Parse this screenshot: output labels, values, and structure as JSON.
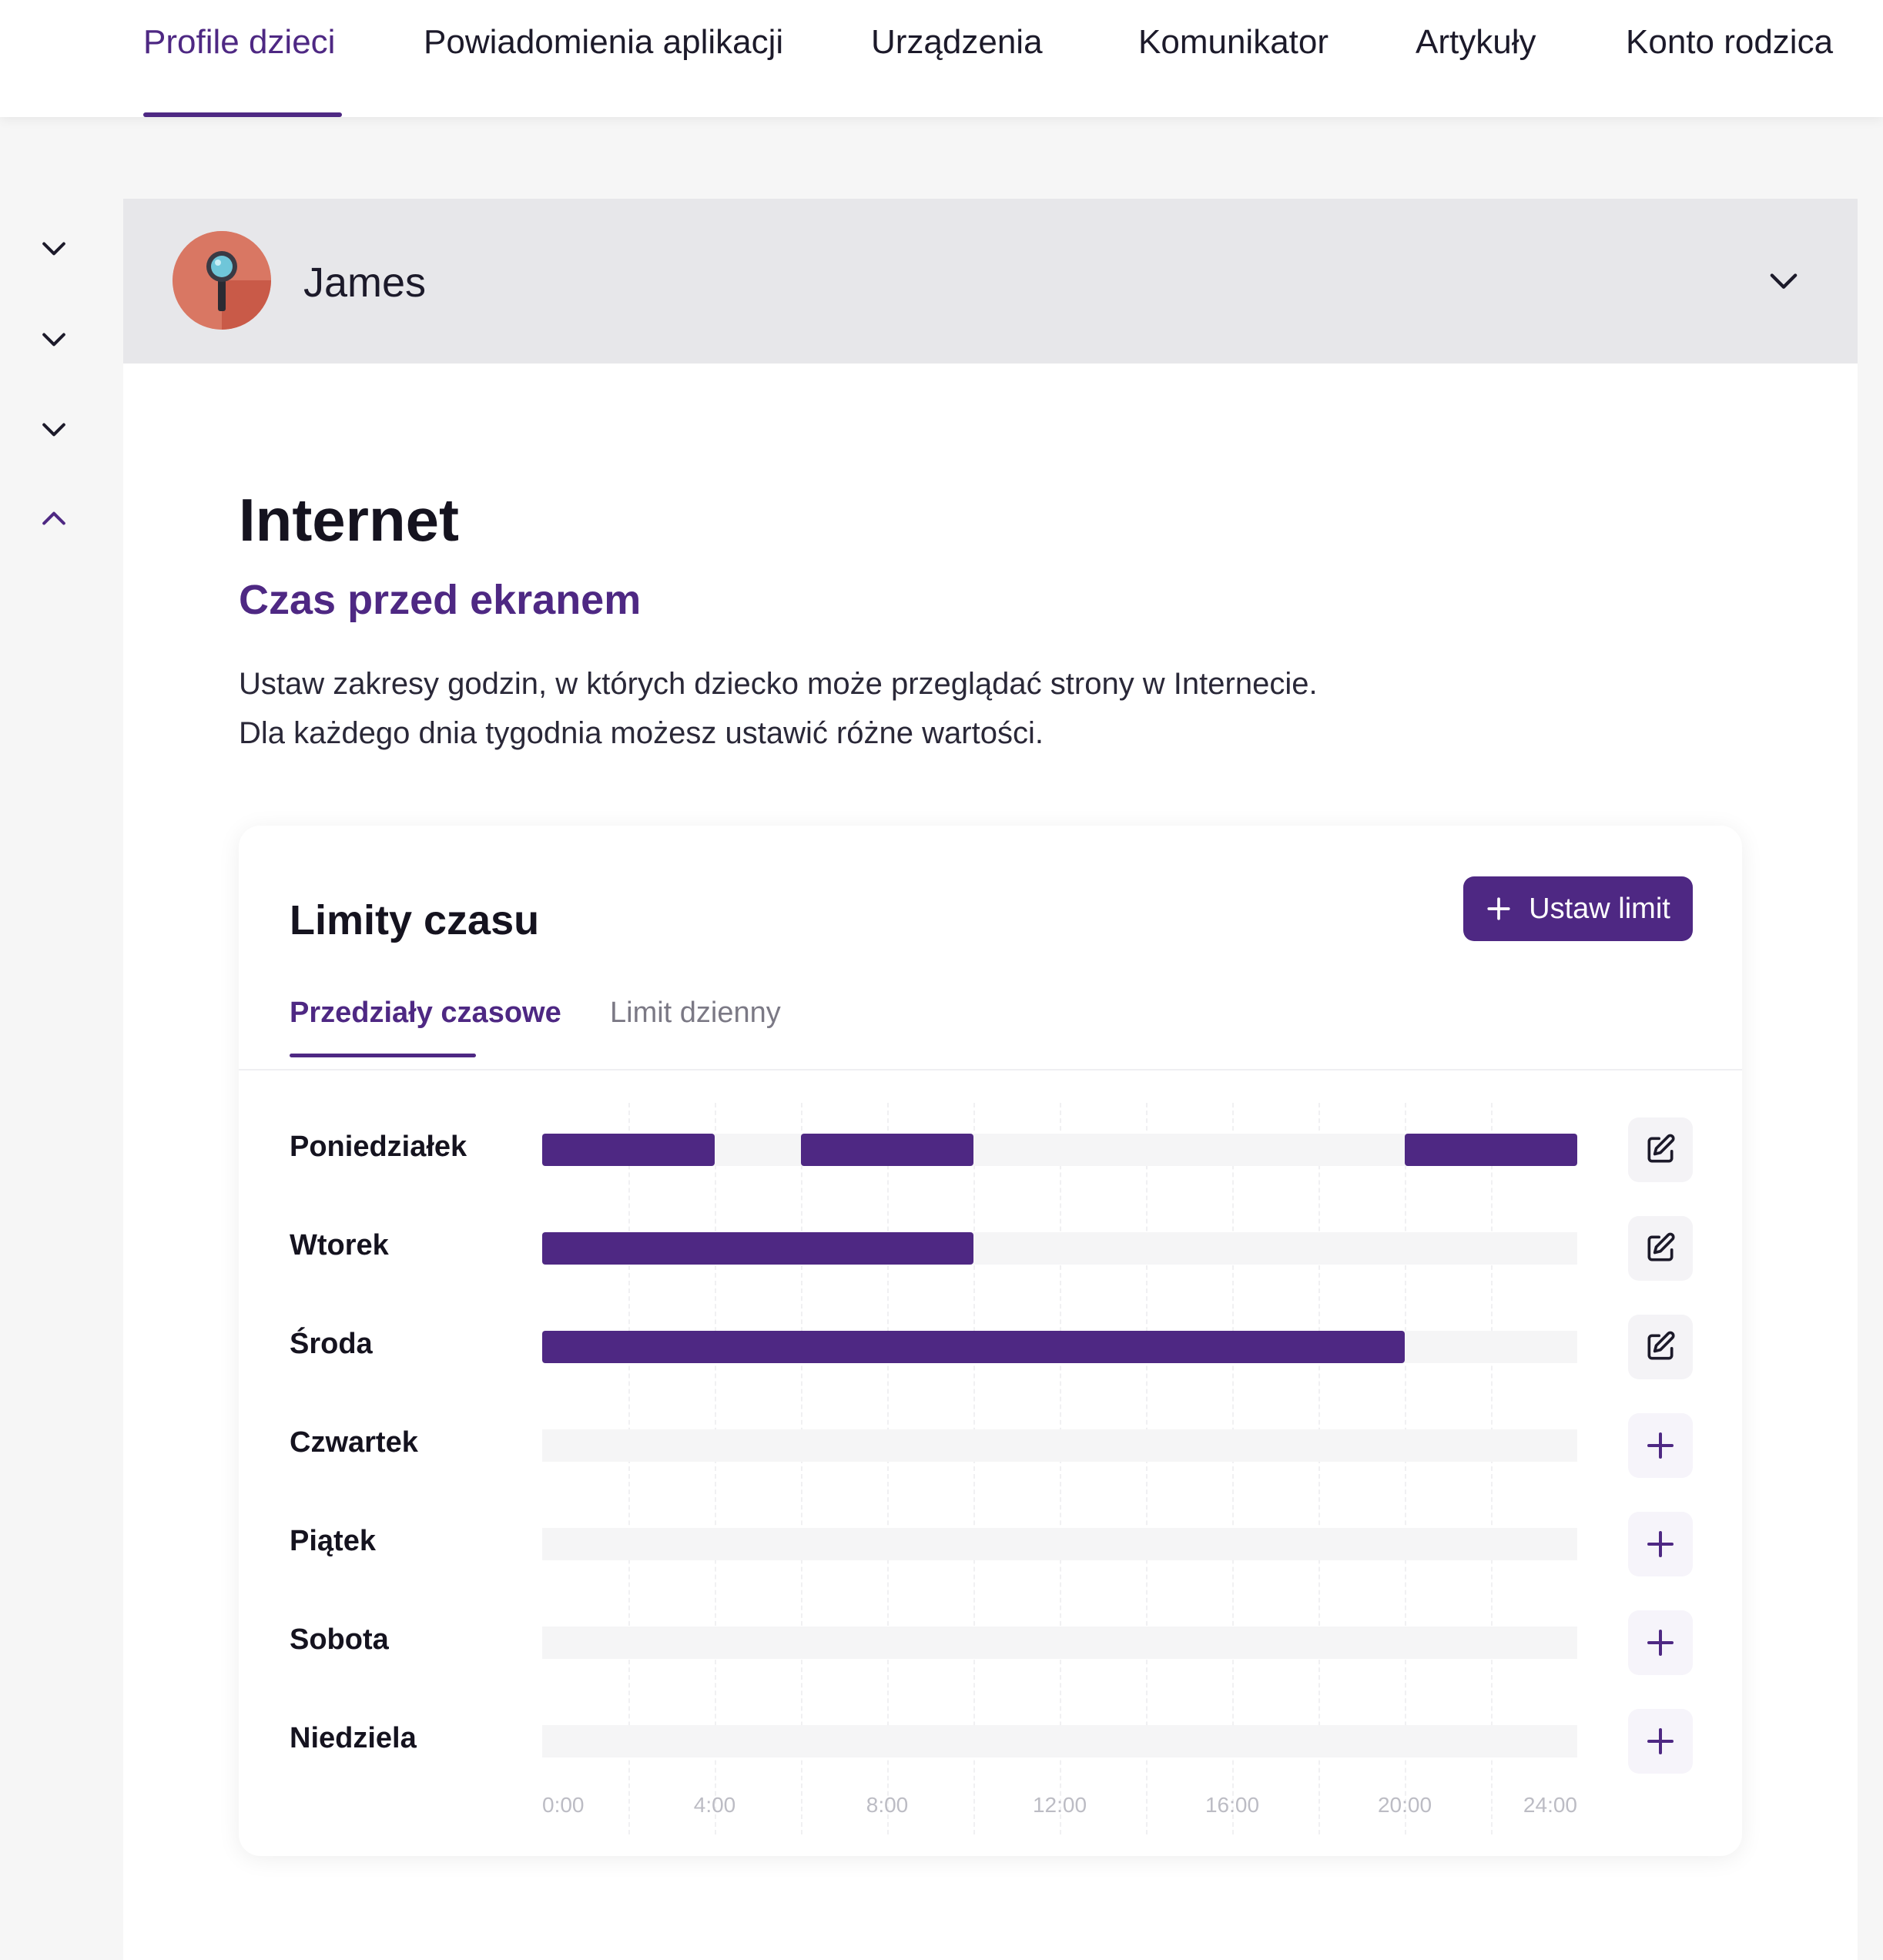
{
  "nav": {
    "items": [
      {
        "label": "Profile dzieci",
        "active": true
      },
      {
        "label": "Powiadomienia aplikacji",
        "active": false
      },
      {
        "label": "Urządzenia",
        "active": false
      },
      {
        "label": "Komunikator",
        "active": false
      },
      {
        "label": "Artykuły",
        "active": false
      },
      {
        "label": "Konto rodzica",
        "active": false
      }
    ]
  },
  "sidebar": {
    "toggles": [
      "chevron-down-icon",
      "chevron-down-icon",
      "chevron-down-icon",
      "chevron-up-icon"
    ]
  },
  "profile": {
    "name": "James",
    "avatar_icon": "magnifier-icon"
  },
  "section": {
    "title": "Internet",
    "subtitle": "Czas przed ekranem",
    "description_line1": "Ustaw zakresy godzin, w których dziecko może przeglądać strony w Internecie.",
    "description_line2": "Dla każdego dnia tygodnia możesz ustawić różne wartości."
  },
  "card": {
    "title": "Limity czasu",
    "set_limit_label": "Ustaw limit",
    "tabs": [
      {
        "label": "Przedziały czasowe",
        "active": true
      },
      {
        "label": "Limit dzienny",
        "active": false
      }
    ]
  },
  "chart_data": {
    "type": "timeline",
    "x_axis_hours": [
      0,
      24
    ],
    "tick_labels": [
      "0:00",
      "4:00",
      "8:00",
      "12:00",
      "16:00",
      "20:00",
      "24:00"
    ],
    "days": [
      {
        "label": "Poniedziałek",
        "intervals": [
          [
            0,
            4
          ],
          [
            6,
            10
          ],
          [
            20,
            24
          ]
        ],
        "action": "edit-icon"
      },
      {
        "label": "Wtorek",
        "intervals": [
          [
            0,
            10
          ]
        ],
        "action": "edit-icon"
      },
      {
        "label": "Środa",
        "intervals": [
          [
            0,
            20
          ]
        ],
        "action": "edit-icon"
      },
      {
        "label": "Czwartek",
        "intervals": [],
        "action": "plus-icon"
      },
      {
        "label": "Piątek",
        "intervals": [],
        "action": "plus-icon"
      },
      {
        "label": "Sobota",
        "intervals": [],
        "action": "plus-icon"
      },
      {
        "label": "Niedziela",
        "intervals": [],
        "action": "plus-icon"
      }
    ]
  },
  "colors": {
    "accent": "#4e2883",
    "track": "#f5f5f6",
    "axis_label": "#bcbcc4"
  }
}
